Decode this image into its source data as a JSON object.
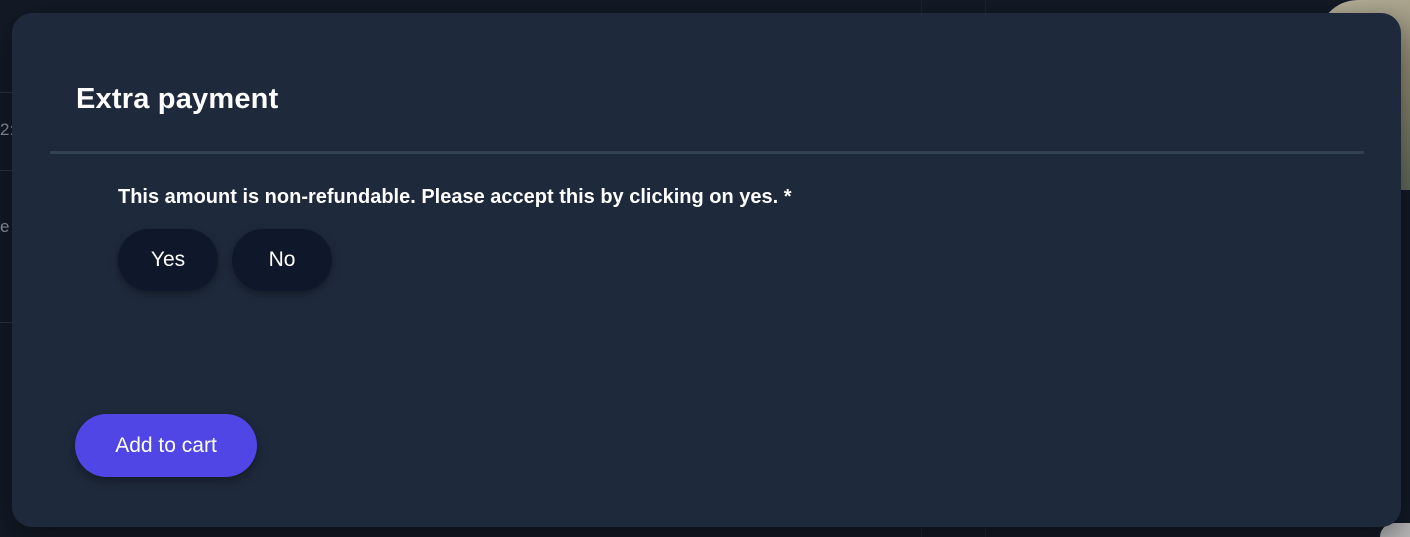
{
  "background": {
    "fragment_top": "2:",
    "fragment_mid": "e"
  },
  "modal": {
    "title": "Extra payment",
    "question": "This amount is non-refundable. Please accept this by clicking on yes. *",
    "options": {
      "yes": "Yes",
      "no": "No"
    },
    "add_to_cart_label": "Add to cart"
  },
  "colors": {
    "modal_bg": "#1e293b",
    "choice_bg": "#0f172a",
    "accent": "#4f46e5",
    "divider": "#334155"
  }
}
